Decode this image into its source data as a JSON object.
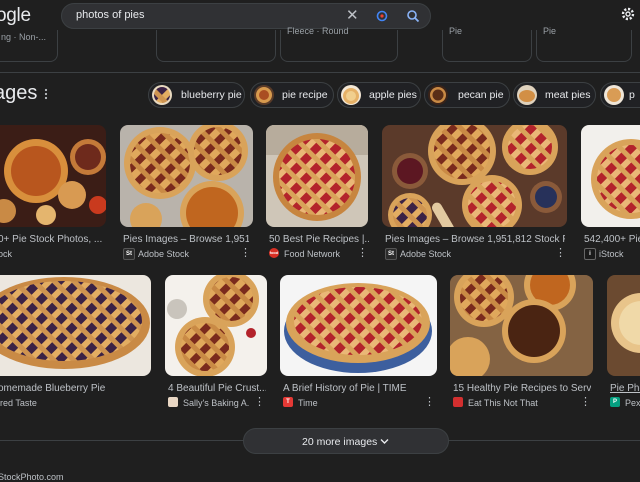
{
  "header": {
    "logo_text": "ogle",
    "search_value": "photos of pies",
    "clear_icon": "close-icon",
    "lens_icon": "google-lens-icon",
    "search_icon": "search-icon",
    "settings_icon": "gear-icon"
  },
  "prev_cards": {
    "c1": "ng · Non-...",
    "c2": "",
    "c3": "Fleece · Round",
    "c4": "Pie",
    "c5": "Pie"
  },
  "images_section": {
    "title": "ages",
    "chips": [
      "blueberry pie",
      "pie recipe",
      "apple pies",
      "pecan pie",
      "meat pies"
    ]
  },
  "row1": [
    {
      "title": "0+ Pie Stock Photos, ...",
      "source": "ock"
    },
    {
      "title": "Pies Images – Browse 1,951,...",
      "source": "Adobe Stock",
      "favicon": "St"
    },
    {
      "title": "50 Best Pie Recipes |...",
      "source": "Food Network",
      "favicon": "food"
    },
    {
      "title": "Pies Images – Browse 1,951,812 Stock Ph...",
      "source": "Adobe Stock",
      "favicon": "St"
    },
    {
      "title": "542,400+ Pie",
      "source": "iStock",
      "favicon": "i"
    }
  ],
  "row2": [
    {
      "title": "omemade Blueberry Pie",
      "source": "ired Taste"
    },
    {
      "title": "4 Beautiful Pie Crust...",
      "source": "Sally's Baking A..."
    },
    {
      "title": "A Brief History of Pie | TIME",
      "source": "Time",
      "favicon": "T"
    },
    {
      "title": "15 Healthy Pie Recipes to Serv...",
      "source": "Eat This Not That"
    },
    {
      "title": "Pie Pho",
      "source": "Pexe",
      "favicon": "P"
    }
  ],
  "more_button": "20 more images",
  "footer": "StockPhoto.com",
  "colors": {
    "background": "#1f1f1f",
    "crust": "#d9a35a",
    "pumpkin": "#b8561e",
    "cherry": "#b3232b"
  }
}
